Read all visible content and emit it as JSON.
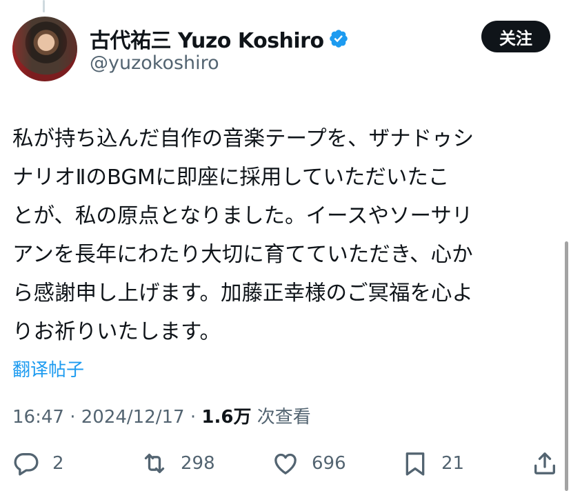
{
  "author": {
    "display_name": "古代祐三 Yuzo Koshiro",
    "handle": "@yuzokoshiro",
    "verified_icon": "verified-badge-icon"
  },
  "follow_label": "关注",
  "tweet": {
    "lines": [
      "私が持ち込んだ自作の音楽テープを、ザナドゥシ",
      "ナリオⅡのBGMに即座に採用していただいたこ",
      "とが、私の原点となりました。イースやソーサリ",
      "アンを長年にわたり大切に育てていただき、心か",
      "ら感謝申し上げます。加藤正幸様のご冥福を心よ",
      "りお祈りいたします。"
    ]
  },
  "translate_label": "翻译帖子",
  "meta": {
    "time": "16:47",
    "sep1": " · ",
    "date": "2024/12/17",
    "sep2": " · ",
    "views": "1.6万",
    "views_label": " 次查看"
  },
  "actions": {
    "reply": {
      "icon": "reply-icon",
      "count": "2"
    },
    "repost": {
      "icon": "repost-icon",
      "count": "298"
    },
    "like": {
      "icon": "heart-icon",
      "count": "696"
    },
    "bookmark": {
      "icon": "bookmark-icon",
      "count": "21"
    },
    "share": {
      "icon": "share-icon"
    }
  },
  "colors": {
    "link": "#1d9bf0",
    "muted": "#536471",
    "text": "#0f1419",
    "verified": "#1d9bf0"
  }
}
